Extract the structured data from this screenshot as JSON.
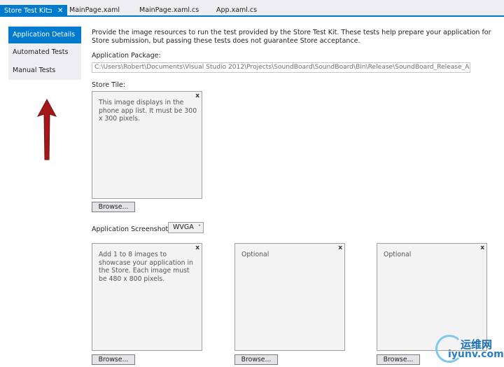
{
  "tabs": [
    {
      "label": "Store Test Kit",
      "pin": "⊐",
      "close": "✕"
    },
    {
      "label": "MainPage.xaml"
    },
    {
      "label": "MainPage.xaml.cs"
    },
    {
      "label": "App.xaml.cs"
    }
  ],
  "nav": {
    "items": [
      {
        "label": "Application Details"
      },
      {
        "label": "Automated Tests"
      },
      {
        "label": "Manual Tests"
      }
    ]
  },
  "main": {
    "description": "Provide the image resources to run the test provided by the Store Test Kit. These tests help prepare your application for Store submission, but passing these tests does not guarantee Store acceptance.",
    "package_label": "Application Package:",
    "package_path": "C:\\Users\\Robert\\Documents\\Visual Studio 2012\\Projects\\SoundBoard\\SoundBoard\\Bin\\Release\\SoundBoard_Release_AnyCPU.xap",
    "store_tile_label": "Store Tile:",
    "store_tile_text": "This image displays in the phone app list. It must be 300 x 300 pixels.",
    "browse_label": "Browse...",
    "close_glyph": "x",
    "screenshots_label": "Application Screenshots:",
    "resolution_value": "WVGA",
    "chevron": "˅",
    "screenshot1_text": "Add 1 to 8 images to showcase your application in the Store. Each image must be 480 x 800 pixels.",
    "optional_text": "Optional"
  },
  "watermark": {
    "cn": "运维网",
    "en": "iyunv.com"
  },
  "colors": {
    "accent": "#007acc",
    "arrow": "#a01818"
  }
}
